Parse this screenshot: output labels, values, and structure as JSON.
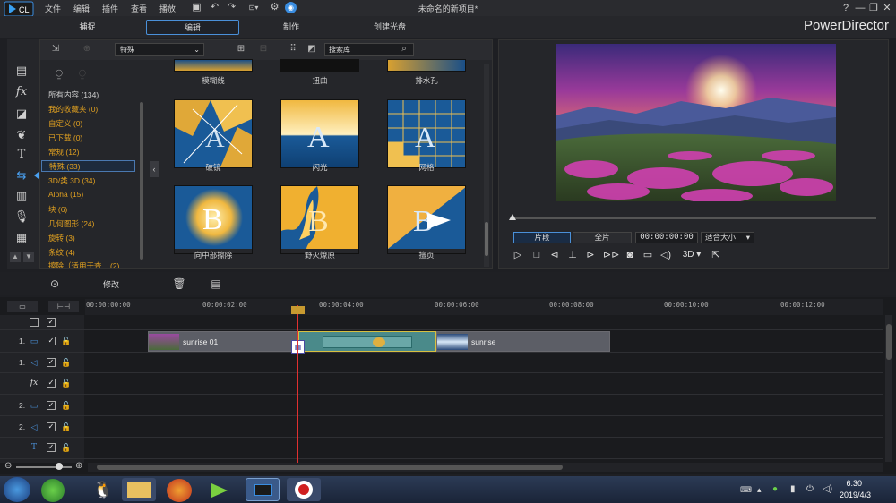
{
  "menu": [
    "文件",
    "编辑",
    "插件",
    "查看",
    "播放"
  ],
  "document_title": "未命名的新项目*",
  "window_controls": {
    "help": "?",
    "minimize": "—",
    "restore": "❐",
    "close": "✕"
  },
  "mode_tabs": [
    {
      "label": "捕捉",
      "active": false
    },
    {
      "label": "编辑",
      "active": true
    },
    {
      "label": "制作",
      "active": false
    },
    {
      "label": "创建光盘",
      "active": false
    }
  ],
  "brand": "PowerDirector",
  "library": {
    "category_select": "特殊",
    "search_placeholder": "搜索库",
    "categories": [
      {
        "label": "所有内容 (134)",
        "style": "plain"
      },
      {
        "label": "我的收藏夹  (0)",
        "style": "orange"
      },
      {
        "label": "自定义  (0)",
        "style": "orange"
      },
      {
        "label": "已下载  (0)",
        "style": "orange"
      },
      {
        "label": "常规  (12)",
        "style": "orange"
      },
      {
        "label": "特殊  (33)",
        "style": "selected"
      },
      {
        "label": "3D/类 3D  (34)",
        "style": "orange"
      },
      {
        "label": "Alpha  (15)",
        "style": "orange"
      },
      {
        "label": "块  (6)",
        "style": "orange"
      },
      {
        "label": "几何图形  (24)",
        "style": "orange"
      },
      {
        "label": "旋转  (3)",
        "style": "orange"
      },
      {
        "label": "条纹  (4)",
        "style": "orange"
      },
      {
        "label": "擦除（适用于查...  (2)",
        "style": "orange"
      }
    ],
    "transitions": [
      {
        "label": "模糊线",
        "letter": ""
      },
      {
        "label": "扭曲",
        "letter": ""
      },
      {
        "label": "排水孔",
        "letter": ""
      },
      {
        "label": "破镜",
        "letter": "A"
      },
      {
        "label": "闪光",
        "letter": "A"
      },
      {
        "label": "网格",
        "letter": "A"
      },
      {
        "label": "向中部擦除",
        "letter": "B"
      },
      {
        "label": "野火燎原",
        "letter": "B"
      },
      {
        "label": "擅页",
        "letter": "B"
      }
    ]
  },
  "preview": {
    "clip_button": "片段",
    "full_button": "全片",
    "timecode": "00:00:00:00",
    "fit_select": "适合大小",
    "three_d": "3D"
  },
  "edit_toolbar": {
    "modify": "修改"
  },
  "timeline": {
    "ticks": [
      "00:00:00:00",
      "00:00:02:00",
      "00:00:04:00",
      "00:00:06:00",
      "00:00:08:00",
      "00:00:10:00",
      "00:00:12:00"
    ],
    "track_numbers": [
      "1.",
      "1.",
      "2.",
      "2."
    ],
    "clips": [
      {
        "label": "sunrise 01"
      },
      {
        "label": "sunrise"
      }
    ]
  },
  "taskbar": {
    "time": "6:30",
    "date": "2019/4/3"
  }
}
